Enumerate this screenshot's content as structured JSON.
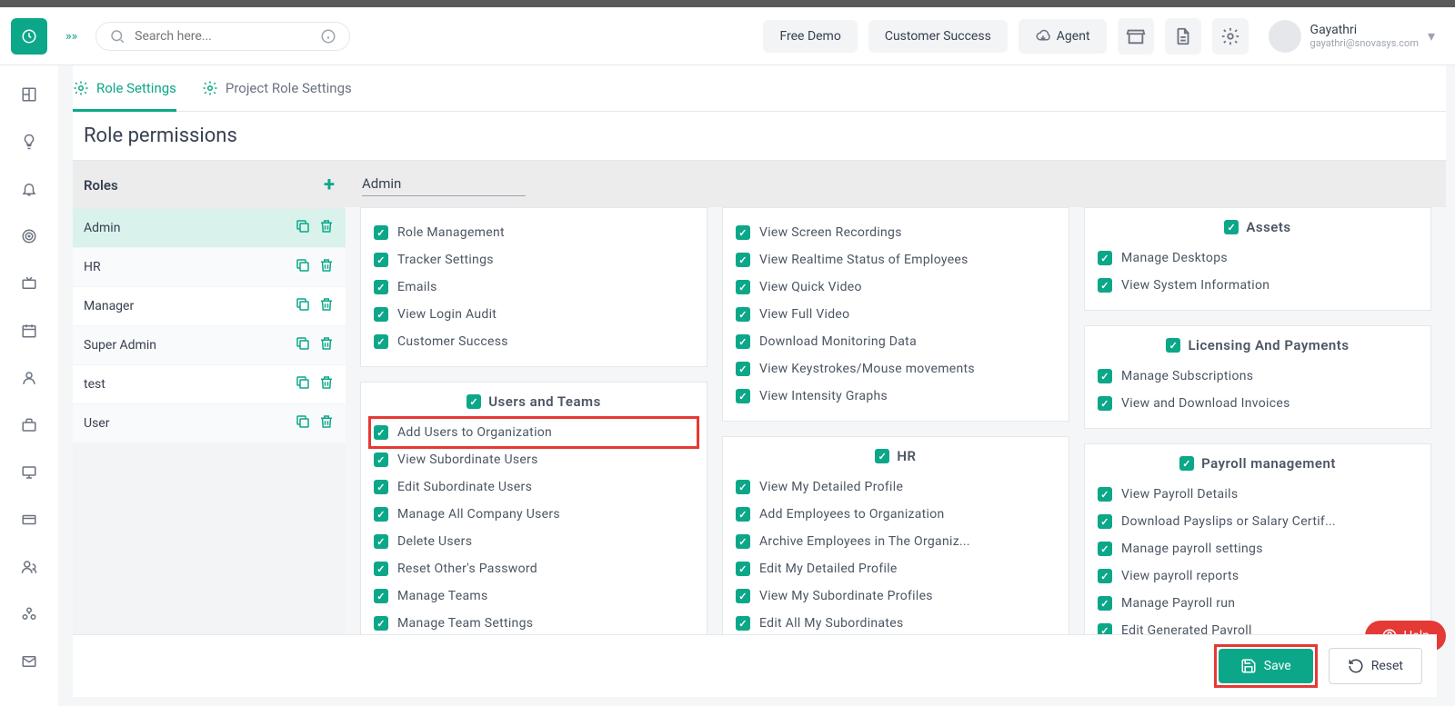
{
  "header": {
    "search_placeholder": "Search here...",
    "free_demo": "Free Demo",
    "customer_success": "Customer Success",
    "agent": "Agent",
    "user_name": "Gayathri",
    "user_email": "gayathri@snovasys.com"
  },
  "tabs": {
    "role_settings": "Role Settings",
    "project_role_settings": "Project Role Settings"
  },
  "page_title": "Role permissions",
  "roles_panel": {
    "title": "Roles",
    "items": [
      "Admin",
      "HR",
      "Manager",
      "Super Admin",
      "test",
      "User"
    ],
    "selected": "Admin"
  },
  "role_input_value": "Admin",
  "col1": {
    "top_items": [
      "Role Management",
      "Tracker Settings",
      "Emails",
      "View Login Audit",
      "Customer Success"
    ],
    "users_teams_title": "Users and Teams",
    "users_teams_items": [
      "Add Users to Organization",
      "View Subordinate Users",
      "Edit Subordinate Users",
      "Manage All Company Users",
      "Delete Users",
      "Reset Other's Password",
      "Manage Teams",
      "Manage Team Settings"
    ]
  },
  "col2": {
    "top_items": [
      "View Screen Recordings",
      "View Realtime Status of Employees",
      "View Quick Video",
      "View Full Video",
      "Download Monitoring Data",
      "View Keystrokes/Mouse movements",
      "View Intensity Graphs"
    ],
    "hr_title": "HR",
    "hr_items": [
      "View My Detailed Profile",
      "Add Employees to Organization",
      "Archive Employees in The Organiz...",
      "Edit My Detailed Profile",
      "View My Subordinate Profiles",
      "Edit All My Subordinates"
    ]
  },
  "col3": {
    "assets_title": "Assets",
    "assets_items": [
      "Manage Desktops",
      "View System Information"
    ],
    "licensing_title": "Licensing And Payments",
    "licensing_items": [
      "Manage Subscriptions",
      "View and Download Invoices"
    ],
    "payroll_title": "Payroll management",
    "payroll_items": [
      "View Payroll Details",
      "Download Payslips or Salary Certif...",
      "Manage payroll settings",
      "View payroll reports",
      "Manage Payroll run",
      "Edit Generated Payroll"
    ]
  },
  "footer": {
    "save": "Save",
    "reset": "Reset"
  },
  "help": "Help"
}
